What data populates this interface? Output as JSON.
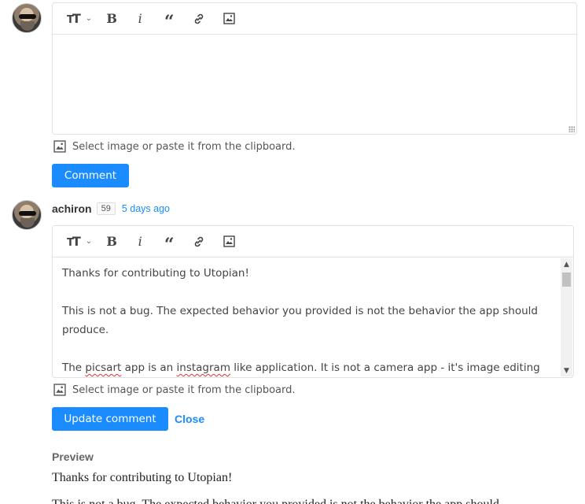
{
  "editor_top": {
    "toolbar": {
      "heading_label": "T",
      "bold_label": "B",
      "italic_label": "i",
      "quote_label": "“"
    },
    "content": "",
    "hint": "Select image or paste it from the clipboard.",
    "submit_label": "Comment"
  },
  "comment": {
    "author": "achiron",
    "reputation": "59",
    "time": "5 days ago"
  },
  "editor_edit": {
    "toolbar": {
      "heading_label": "T",
      "bold_label": "B",
      "italic_label": "i",
      "quote_label": "“"
    },
    "paragraphs": {
      "p1": "Thanks for contributing to Utopian!",
      "p2": "This is not a bug. The expected behavior you provided is not the behavior the app should produce.",
      "p3a": "The ",
      "p3b": "picsart",
      "p3c": " app is an ",
      "p3d": "instagram",
      "p3e": " like application. It is not a camera app - it's image editing one."
    },
    "hint": "Select image or paste it from the clipboard.",
    "update_label": "Update comment",
    "close_label": "Close"
  },
  "preview": {
    "label": "Preview",
    "p1": "Thanks for contributing to Utopian!",
    "p2": "This is not a bug. The expected behavior you provided is not the behavior the app should"
  },
  "colors": {
    "accent": "#1a8cff",
    "border": "#e2e2e2",
    "spellcheck": "#d33"
  }
}
